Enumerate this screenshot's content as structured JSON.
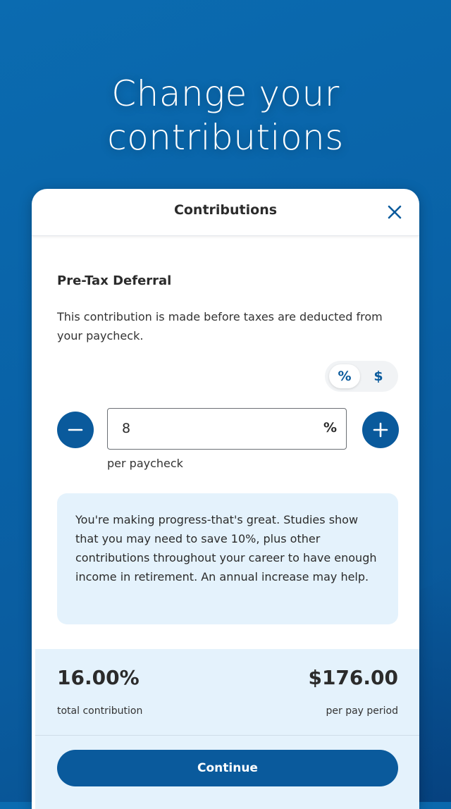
{
  "promo": {
    "headline_line1": "Change your",
    "headline_line2": "contributions"
  },
  "sheet": {
    "title": "Contributions",
    "close_icon": "close-icon"
  },
  "deferral": {
    "title": "Pre-Tax Deferral",
    "description": "This contribution is made before taxes are deducted from your paycheck."
  },
  "toggle": {
    "percent_label": "%",
    "dollar_label": "$",
    "selected": "%"
  },
  "amount": {
    "value": "8",
    "unit": "%",
    "per_label": "per paycheck",
    "decrement_icon": "minus-icon",
    "increment_icon": "plus-icon"
  },
  "info": {
    "message": "You're making progress-that's great. Studies show that you may need to save 10%, plus other contributions throughout your career to have enough income in retirement. An annual increase may help."
  },
  "summary": {
    "total_percent": "16.00%",
    "total_label": "total contribution",
    "amount": "$176.00",
    "amount_label": "per pay period"
  },
  "actions": {
    "continue_label": "Continue"
  },
  "colors": {
    "brand_blue": "#0a5a9c",
    "background_blue": "#0b6bb0",
    "info_background": "#e4f2fc"
  }
}
